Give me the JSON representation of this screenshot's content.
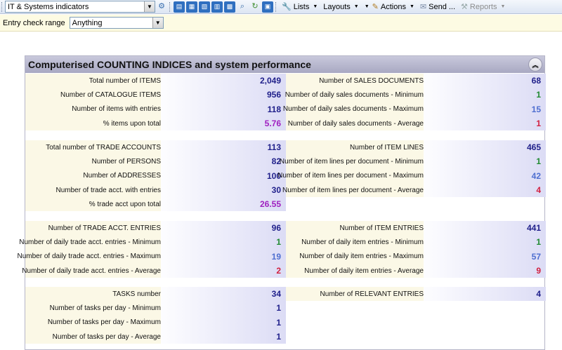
{
  "toolbar": {
    "view_selector": "IT & Systems indicators",
    "lists_label": "Lists",
    "layouts_label": "Layouts",
    "actions_label": "Actions",
    "send_label": "Send ...",
    "reports_label": "Reports"
  },
  "filter": {
    "label": "Entry check range",
    "value": "Anything"
  },
  "panel": {
    "title": "Computerised COUNTING INDICES and system performance"
  },
  "groups": [
    {
      "left": [
        {
          "label": "Total number of ITEMS",
          "value": "2,049",
          "color": "#1f1f8a"
        },
        {
          "label": "Number of CATALOGUE ITEMS",
          "value": "956",
          "color": "#1f1f8a"
        },
        {
          "label": "Number of items with entries",
          "value": "118",
          "color": "#1f1f8a"
        },
        {
          "label": "% items upon total",
          "value": "5.76",
          "color": "#a020c0"
        }
      ],
      "right": [
        {
          "label": "Number of SALES DOCUMENTS",
          "value": "68",
          "color": "#1f1f8a"
        },
        {
          "label": "Number of daily sales documents - Minimum",
          "value": "1",
          "color": "#1f8a2f"
        },
        {
          "label": "Number of daily sales documents - Maximum",
          "value": "15",
          "color": "#4f6fd0"
        },
        {
          "label": "Number of daily sales documents - Average",
          "value": "1",
          "color": "#d22040"
        }
      ]
    },
    {
      "left": [
        {
          "label": "Total number of TRADE ACCOUNTS",
          "value": "113",
          "color": "#1f1f8a"
        },
        {
          "label": "Number of PERSONS",
          "value": "82",
          "color": "#1f1f8a"
        },
        {
          "label": "Number of ADDRESSES",
          "value": "100",
          "color": "#1f1f8a"
        },
        {
          "label": "Number of trade acct. with entries",
          "value": "30",
          "color": "#1f1f8a"
        },
        {
          "label": "% trade acct upon total",
          "value": "26.55",
          "color": "#a020c0"
        }
      ],
      "right": [
        {
          "label": "Number of ITEM LINES",
          "value": "465",
          "color": "#1f1f8a"
        },
        {
          "label": "Number of item lines per document - Minimum",
          "value": "1",
          "color": "#1f8a2f"
        },
        {
          "label": "Number of item lines per document - Maximum",
          "value": "42",
          "color": "#4f6fd0"
        },
        {
          "label": "Number of item lines per document - Average",
          "value": "4",
          "color": "#d22040"
        }
      ]
    },
    {
      "left": [
        {
          "label": "Number of TRADE ACCT. ENTRIES",
          "value": "96",
          "color": "#1f1f8a"
        },
        {
          "label": "Number of daily trade acct. entries - Minimum",
          "value": "1",
          "color": "#1f8a2f"
        },
        {
          "label": "Number of daily trade acct. entries - Maximum",
          "value": "19",
          "color": "#4f6fd0"
        },
        {
          "label": "Number of daily trade acct. entries - Average",
          "value": "2",
          "color": "#d22040"
        }
      ],
      "right": [
        {
          "label": "Number of ITEM ENTRIES",
          "value": "441",
          "color": "#1f1f8a"
        },
        {
          "label": "Number of daily item entries - Minimum",
          "value": "1",
          "color": "#1f8a2f"
        },
        {
          "label": "Number of daily item entries - Maximum",
          "value": "57",
          "color": "#4f6fd0"
        },
        {
          "label": "Number of daily item entries - Average",
          "value": "9",
          "color": "#d22040"
        }
      ]
    },
    {
      "left": [
        {
          "label": "TASKS number",
          "value": "34",
          "color": "#1f1f8a"
        },
        {
          "label": "Number of tasks per day - Minimum",
          "value": "1",
          "color": "#1f1f8a"
        },
        {
          "label": "Number of tasks per day - Maximum",
          "value": "1",
          "color": "#1f1f8a"
        },
        {
          "label": "Number of tasks per day - Average",
          "value": "1",
          "color": "#1f1f8a"
        }
      ],
      "right": [
        {
          "label": "Number of RELEVANT ENTRIES",
          "value": "4",
          "color": "#1f1f8a"
        }
      ]
    }
  ]
}
